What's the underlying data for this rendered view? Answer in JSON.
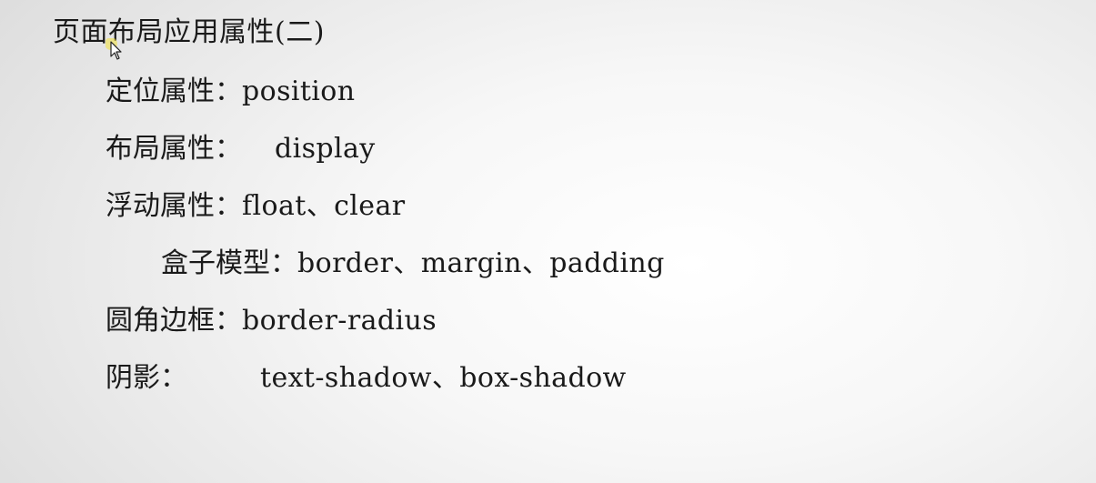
{
  "slide": {
    "title": "页面布局应用属性(二)",
    "items": [
      {
        "label": "定位属性：",
        "value": "position"
      },
      {
        "label": "布局属性：",
        "value": "display"
      },
      {
        "label": "浮动属性：",
        "value": "float、clear"
      },
      {
        "label": "盒子模型：",
        "value": "border、margin、padding"
      },
      {
        "label": "圆角边框：",
        "value": "border-radius"
      },
      {
        "label": "阴影：",
        "value": "text-shadow、box-shadow"
      }
    ]
  },
  "cursor": {
    "icon": "mouse-pointer-icon",
    "highlight_color": "#f2e23a"
  }
}
